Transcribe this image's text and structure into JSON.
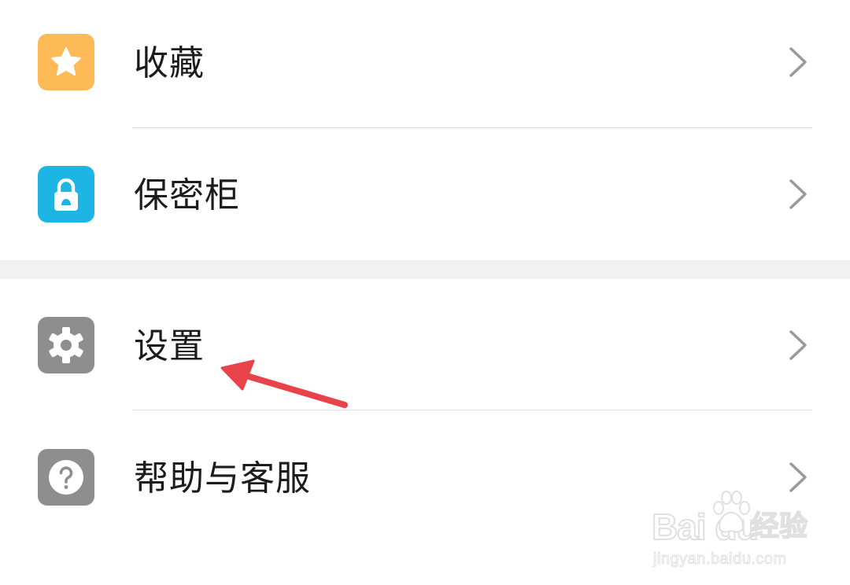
{
  "menu": {
    "items": [
      {
        "label": "收藏",
        "icon": "star-icon",
        "color": "#FDBA57"
      },
      {
        "label": "保密柜",
        "icon": "lock-icon",
        "color": "#1DB5E4"
      },
      {
        "label": "设置",
        "icon": "gear-icon",
        "color": "#8E8E8E"
      },
      {
        "label": "帮助与客服",
        "icon": "help-icon",
        "color": "#8E8E8E"
      }
    ]
  },
  "annotation": {
    "icon": "red-arrow-icon",
    "color": "#E8434A"
  },
  "watermark": {
    "brand": "Bai du",
    "service": "经验",
    "url": "jingyan.baidu.com"
  }
}
